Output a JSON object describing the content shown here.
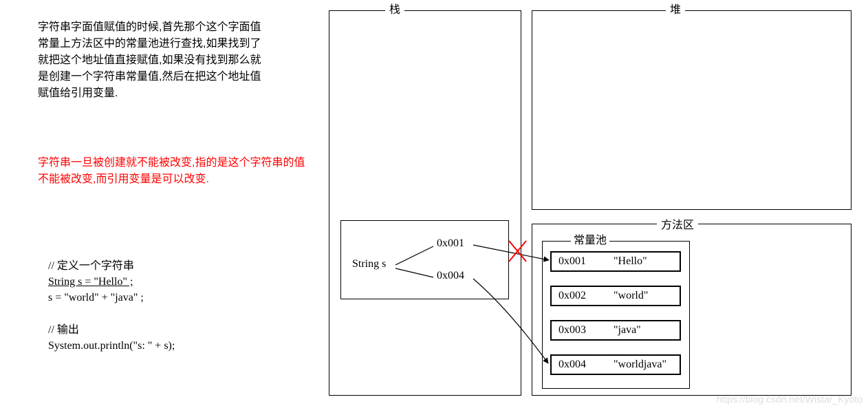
{
  "paragraph1": "字符串字面值赋值的时候,首先那个这个字面值常量上方法区中的常量池进行查找,如果找到了就把这个地址值直接赋值,如果没有找到那么就是创建一个字符串常量值,然后在把这个地址值赋值给引用变量.",
  "paragraph2": "字符串一旦被创建就不能被改变,指的是这个字符串的值不能被改变,而引用变量是可以改变.",
  "code": {
    "c1": "// 定义一个字符串",
    "c2": "String s = \"Hello\" ;",
    "c3": "s = \"world\" + \"java\" ;",
    "c4": "// 输出",
    "c5": "System.out.println(\"s: \" + s);"
  },
  "labels": {
    "stack": "栈",
    "heap": "堆",
    "method_area": "方法区",
    "const_pool": "常量池",
    "var": "String s",
    "addr1": "0x001",
    "addr2": "0x004"
  },
  "pool": [
    {
      "addr": "0x001",
      "val": "\"Hello\""
    },
    {
      "addr": "0x002",
      "val": "\"world\""
    },
    {
      "addr": "0x003",
      "val": "\"java\""
    },
    {
      "addr": "0x004",
      "val": "\"worldjava\""
    }
  ],
  "watermark": "https://blog.csdn.net/Wistar_Kyoto"
}
